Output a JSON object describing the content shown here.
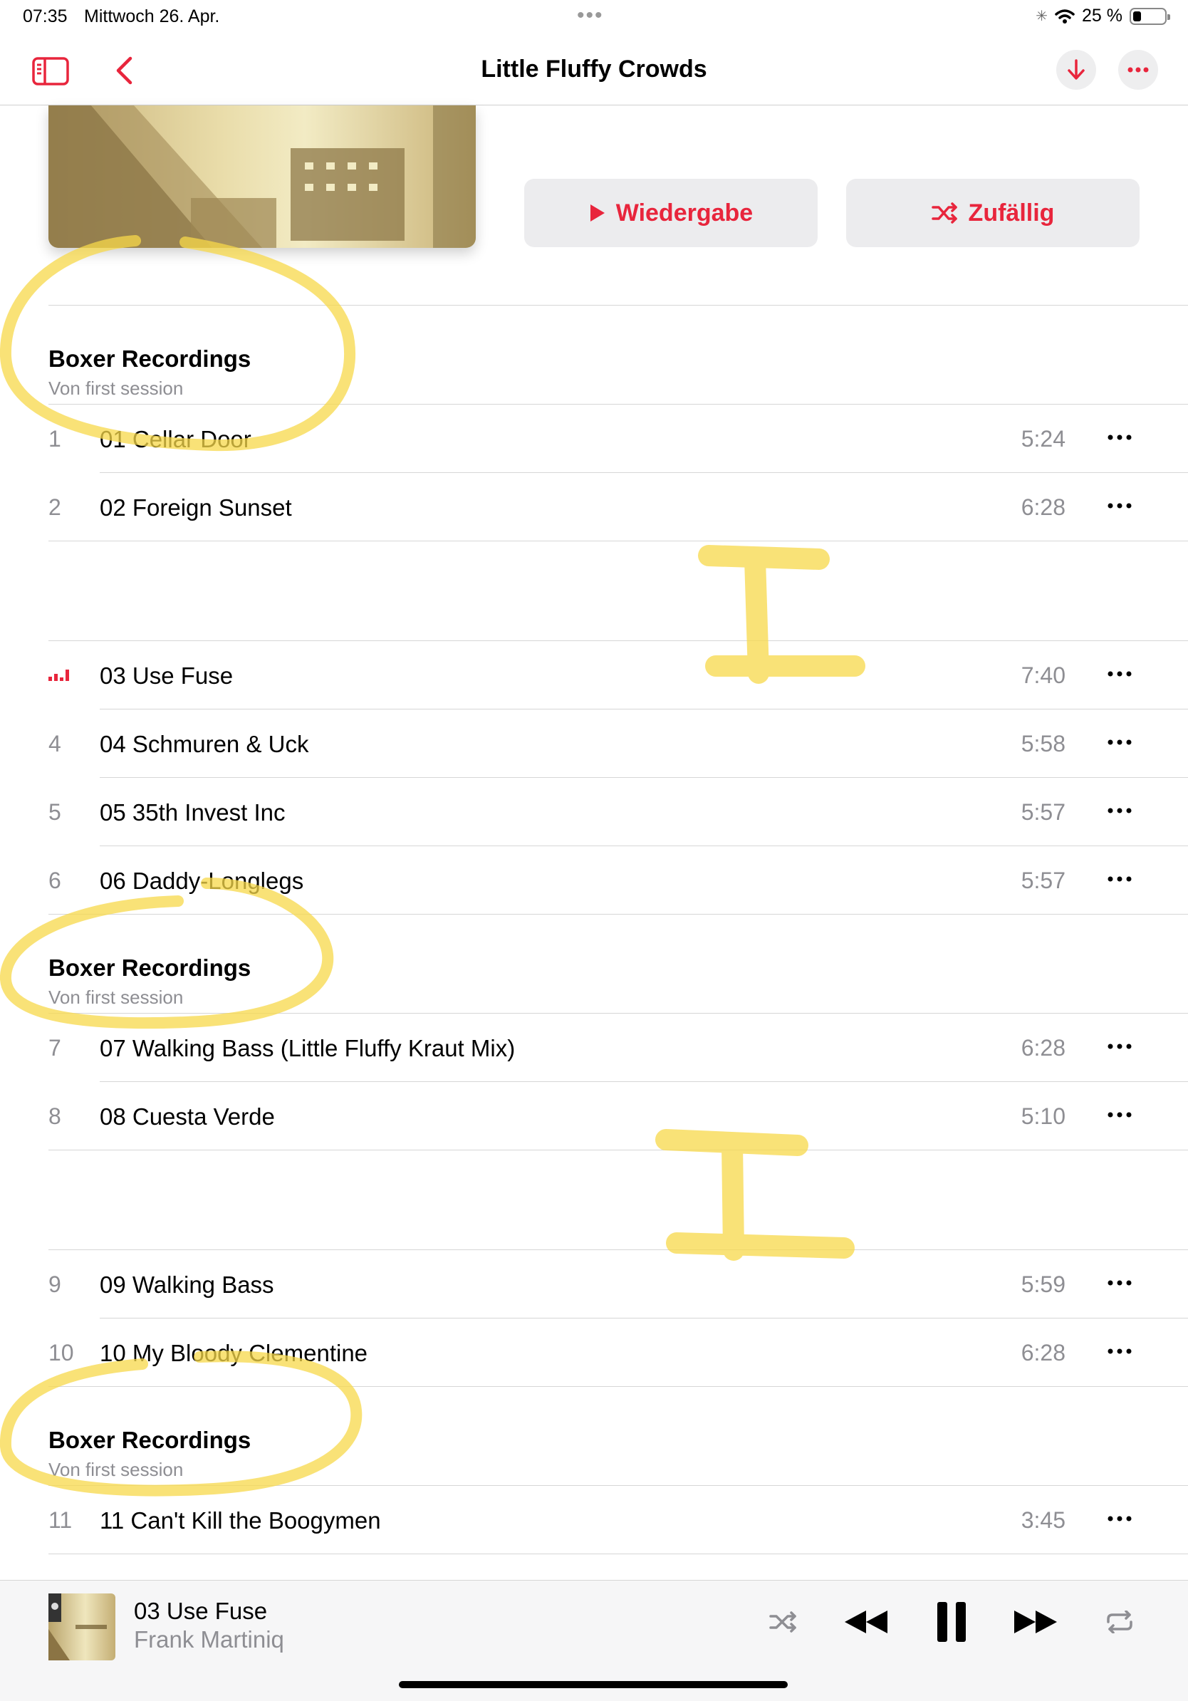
{
  "status": {
    "time": "07:35",
    "date": "Mittwoch 26. Apr.",
    "battery_text": "25 %",
    "battery_level": 0.25
  },
  "nav": {
    "title": "Little Fluffy Crowds",
    "sidebar_icon": "sidebar-icon",
    "back_icon": "chevron-left-icon",
    "download_icon": "download-arrow-icon",
    "more_icon": "ellipsis-icon"
  },
  "actions": {
    "play_label": "Wiedergabe",
    "shuffle_label": "Zufällig"
  },
  "discs": [
    {
      "title": "Boxer Recordings",
      "subtitle": "Von first session",
      "groups": [
        [
          {
            "num": "1",
            "title": "01 Cellar Door",
            "duration": "5:24"
          },
          {
            "num": "2",
            "title": "02 Foreign Sunset",
            "duration": "6:28"
          }
        ],
        [
          {
            "num": "",
            "title": "03 Use Fuse",
            "duration": "7:40",
            "playing": true
          },
          {
            "num": "4",
            "title": "04 Schmuren & Uck",
            "duration": "5:58"
          },
          {
            "num": "5",
            "title": "05 35th Invest Inc",
            "duration": "5:57"
          },
          {
            "num": "6",
            "title": "06 Daddy-Longlegs",
            "duration": "5:57"
          }
        ]
      ]
    },
    {
      "title": "Boxer Recordings",
      "subtitle": "Von first session",
      "groups": [
        [
          {
            "num": "7",
            "title": "07 Walking Bass (Little Fluffy Kraut Mix)",
            "duration": "6:28"
          },
          {
            "num": "8",
            "title": "08 Cuesta Verde",
            "duration": "5:10"
          }
        ],
        [
          {
            "num": "9",
            "title": "09 Walking Bass",
            "duration": "5:59"
          },
          {
            "num": "10",
            "title": "10 My Bloody Clementine",
            "duration": "6:28"
          }
        ]
      ]
    },
    {
      "title": "Boxer Recordings",
      "subtitle": "Von first session",
      "groups": [
        [
          {
            "num": "11",
            "title": "11 Can't Kill the Boogymen",
            "duration": "3:45"
          }
        ]
      ]
    }
  ],
  "mini_player": {
    "title": "03 Use Fuse",
    "artist": "Frank Martiniq"
  },
  "colors": {
    "accent": "#e8253c",
    "secondary_text": "#8e8e93",
    "button_bg": "#ececee",
    "highlighter": "#f7d84a"
  }
}
